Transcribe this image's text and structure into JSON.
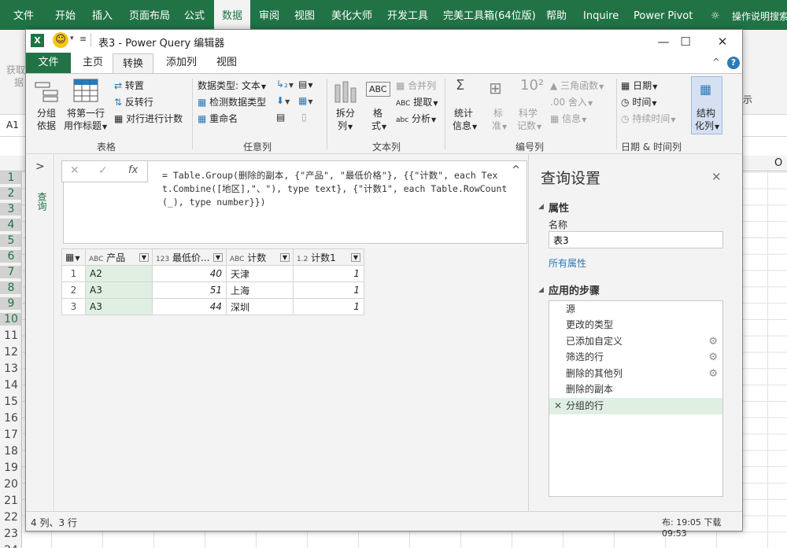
{
  "excel": {
    "tabs": [
      "文件",
      "开始",
      "插入",
      "页面布局",
      "公式",
      "数据",
      "审阅",
      "视图",
      "美化大师",
      "开发工具",
      "完美工具箱(64位版)",
      "帮助",
      "Inquire",
      "Power Pivot",
      "操作说明搜索"
    ],
    "name_box": "A1",
    "col_o": "O",
    "rows": [
      "1",
      "2",
      "3",
      "4",
      "5",
      "6",
      "7",
      "8",
      "9",
      "10",
      "11",
      "12",
      "13",
      "14",
      "15",
      "16",
      "17",
      "18",
      "19",
      "20",
      "21",
      "22",
      "23",
      "24"
    ],
    "ribbon_partial_1": "获取",
    "ribbon_partial_2": "据",
    "ribbon_partial_3": "示",
    "status_partial": "布: 19:05 下载 09:53"
  },
  "window": {
    "title": "表3 - Power Query 编辑器",
    "minimize": "—",
    "maximize": "☐",
    "close": "✕"
  },
  "tabs": {
    "file": "文件",
    "home": "主页",
    "transform": "转换",
    "add_column": "添加列",
    "view": "视图",
    "collapse": "^",
    "help": "?"
  },
  "ribbon": {
    "table": {
      "label": "表格",
      "group_by_1": "分组",
      "group_by_2": "依据",
      "first_row_1": "将第一行",
      "first_row_2": "用作标题",
      "transpose": "转置",
      "reverse_rows": "反转行",
      "count_rows": "对行进行计数"
    },
    "any_column": {
      "label": "任意列",
      "data_type": "数据类型: 文本",
      "detect_type": "检测数据类型",
      "rename": "重命名"
    },
    "text_column": {
      "label": "文本列",
      "split_1": "拆分",
      "split_2": "列",
      "format_1": "格",
      "format_2": "式",
      "merge": "合并列",
      "extract": "提取",
      "parse": "分析"
    },
    "number_column": {
      "label": "编号列",
      "stats_1": "统计",
      "stats_2": "信息",
      "standard_1": "标",
      "standard_2": "准",
      "scientific_1": "科学",
      "scientific_2": "记数",
      "trig": "三角函数",
      "rounding": "舍入",
      "info": "信息"
    },
    "datetime": {
      "label": "日期 & 时间列",
      "date": "日期",
      "time": "时间",
      "duration": "持续时间",
      "structured_1": "结构",
      "structured_2": "化列"
    }
  },
  "left_strip": {
    "expand": ">",
    "label": "查询"
  },
  "formula": {
    "cancel": "✕",
    "commit": "✓",
    "fx": "fx",
    "text": "= Table.Group(删除的副本, {\"产品\", \"最低价格\"}, {{\"计数\", each Text.Combine([地区],\"、\"), type text}, {\"计数1\", each Table.RowCount(_), type number}})",
    "collapse": "^"
  },
  "grid": {
    "headers": [
      {
        "type": "ABC",
        "name": "产品"
      },
      {
        "type": "123",
        "name": "最低价..."
      },
      {
        "type": "ABC",
        "name": "计数"
      },
      {
        "type": "1.2",
        "name": "计数1"
      }
    ],
    "rows": [
      {
        "n": "1",
        "product": "A2",
        "price": "40",
        "count": "天津",
        "count1": "1"
      },
      {
        "n": "2",
        "product": "A3",
        "price": "51",
        "count": "上海",
        "count1": "1"
      },
      {
        "n": "3",
        "product": "A3",
        "price": "44",
        "count": "深圳",
        "count1": "1"
      }
    ]
  },
  "settings": {
    "title": "查询设置",
    "close": "✕",
    "properties": "属性",
    "name_label": "名称",
    "name_value": "表3",
    "all_properties": "所有属性",
    "applied_steps": "应用的步骤",
    "steps": [
      "源",
      "更改的类型",
      "已添加自定义",
      "筛选的行",
      "删除的其他列",
      "删除的副本",
      "分组的行"
    ]
  },
  "status": {
    "text": "4 列、3 行"
  },
  "colors": {
    "excel_green": "#217346",
    "selection_green": "#dff0e3"
  }
}
